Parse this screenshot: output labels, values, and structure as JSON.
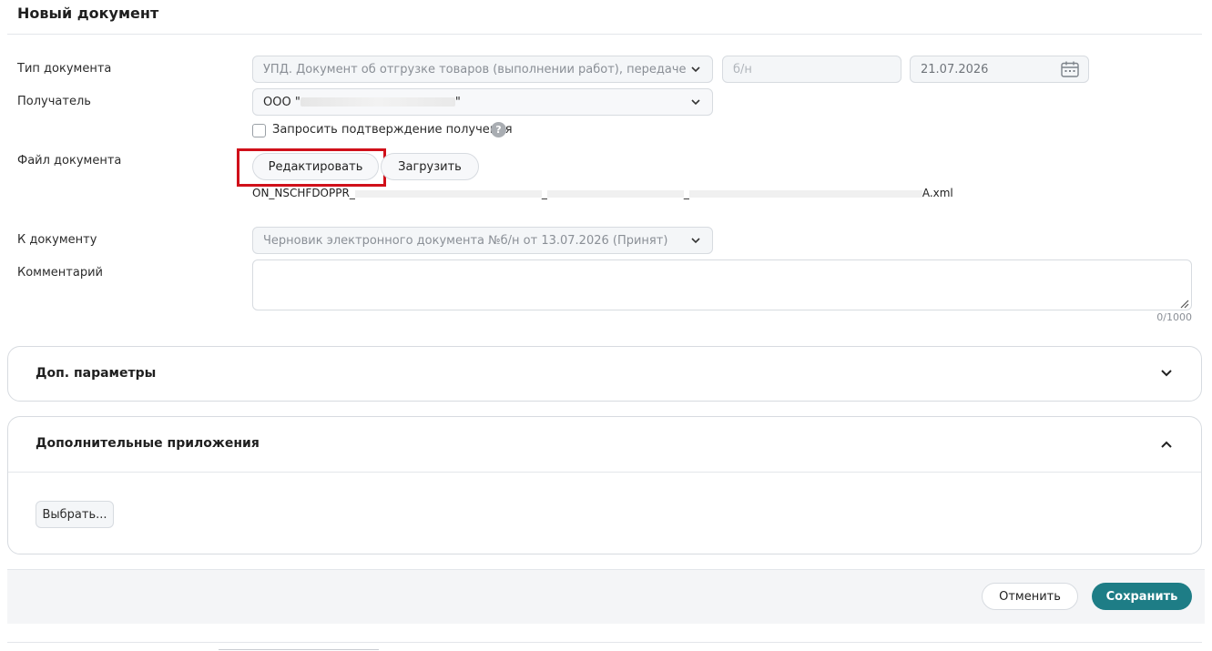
{
  "page": {
    "title": "Новый документ"
  },
  "form": {
    "doc_type": {
      "label": "Тип документа",
      "value": "УПД. Документ об отгрузке товаров (выполнении работ), передаче имущественных прав",
      "number_placeholder": "б/н",
      "date_value": "21.07.2026"
    },
    "recipient": {
      "label": "Получатель",
      "value_prefix": "ООО \"",
      "value_suffix": "\""
    },
    "confirm": {
      "label": "Запросить подтверждение получения",
      "checked": false,
      "help_glyph": "?"
    },
    "file": {
      "label": "Файл документа",
      "edit_button": "Редактировать",
      "upload_button": "Загрузить",
      "filename_start": "ON_NSCHFDOPPR_",
      "filename_sep1": "_",
      "filename_sep2": "_",
      "filename_end": "A.xml"
    },
    "to_document": {
      "label": "К документу",
      "value": "Черновик электронного документа №б/н от 13.07.2026 (Принят)"
    },
    "comment": {
      "label": "Комментарий",
      "value": "",
      "counter": "0/1000"
    }
  },
  "sections": {
    "extra_params": {
      "title": "Доп. параметры",
      "expanded": false
    },
    "attachments": {
      "title": "Дополнительные приложения",
      "expanded": true,
      "choose_button": "Выбрать..."
    }
  },
  "footer": {
    "cancel_label": "Отменить",
    "save_label": "Сохранить"
  },
  "colors": {
    "accent": "#1e7d86",
    "highlight": "#d0101a"
  }
}
